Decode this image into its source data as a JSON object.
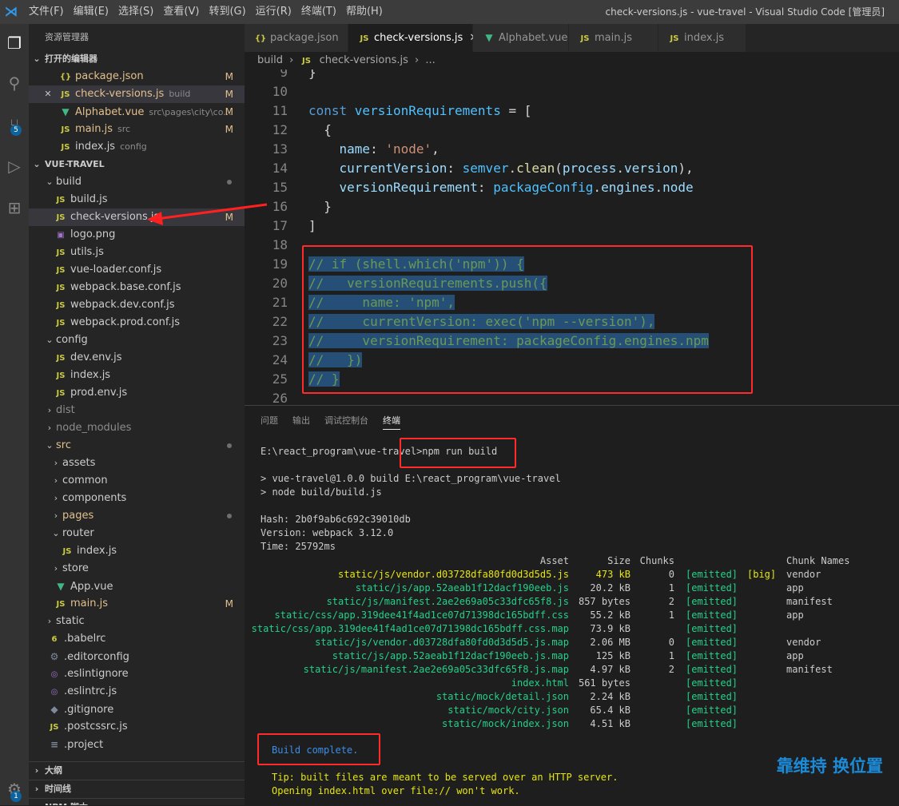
{
  "titlebar": {
    "menus": [
      "文件(F)",
      "编辑(E)",
      "选择(S)",
      "查看(V)",
      "转到(G)",
      "运行(R)",
      "终端(T)",
      "帮助(H)"
    ],
    "window_title": "check-versions.js - vue-travel - Visual Studio Code [管理员]"
  },
  "activity": {
    "scm_badge": "5",
    "accounts_badge": "1"
  },
  "sidebar": {
    "title": "资源管理器",
    "open_editors_label": "打开的编辑器",
    "open_editors": [
      {
        "icon": "{}",
        "name": "package.json",
        "desc": "",
        "mod": "M"
      },
      {
        "icon": "JS",
        "name": "check-versions.js",
        "desc": "build",
        "mod": "M"
      },
      {
        "icon": "V",
        "name": "Alphabet.vue",
        "desc": "src\\pages\\city\\co...",
        "mod": "M"
      },
      {
        "icon": "JS",
        "name": "main.js",
        "desc": "src",
        "mod": "M"
      },
      {
        "icon": "JS",
        "name": "index.js",
        "desc": "config",
        "mod": ""
      }
    ],
    "project_label": "VUE-TRAVEL",
    "tree": [
      {
        "name": "build",
        "kind": "folder-open",
        "depth": 0,
        "dot": true
      },
      {
        "name": "build.js",
        "kind": "js",
        "depth": 1
      },
      {
        "name": "check-versions.js",
        "kind": "js",
        "depth": 1,
        "mod": "M",
        "selected": true
      },
      {
        "name": "logo.png",
        "kind": "img",
        "depth": 1
      },
      {
        "name": "utils.js",
        "kind": "js",
        "depth": 1
      },
      {
        "name": "vue-loader.conf.js",
        "kind": "js",
        "depth": 1
      },
      {
        "name": "webpack.base.conf.js",
        "kind": "js",
        "depth": 1
      },
      {
        "name": "webpack.dev.conf.js",
        "kind": "js",
        "depth": 1
      },
      {
        "name": "webpack.prod.conf.js",
        "kind": "js",
        "depth": 1
      },
      {
        "name": "config",
        "kind": "folder-open",
        "depth": 0
      },
      {
        "name": "dev.env.js",
        "kind": "js",
        "depth": 1
      },
      {
        "name": "index.js",
        "kind": "js",
        "depth": 1
      },
      {
        "name": "prod.env.js",
        "kind": "js",
        "depth": 1
      },
      {
        "name": "dist",
        "kind": "folder",
        "depth": 0,
        "dim": true
      },
      {
        "name": "node_modules",
        "kind": "folder",
        "depth": 0,
        "dim": true
      },
      {
        "name": "src",
        "kind": "folder-open",
        "depth": 0,
        "dot": true,
        "mod_color": true
      },
      {
        "name": "assets",
        "kind": "folder",
        "depth": 1
      },
      {
        "name": "common",
        "kind": "folder",
        "depth": 1
      },
      {
        "name": "components",
        "kind": "folder",
        "depth": 1
      },
      {
        "name": "pages",
        "kind": "folder",
        "depth": 1,
        "dot": true,
        "mod_color": true
      },
      {
        "name": "router",
        "kind": "folder-open",
        "depth": 1
      },
      {
        "name": "index.js",
        "kind": "js",
        "depth": 2
      },
      {
        "name": "store",
        "kind": "folder",
        "depth": 1
      },
      {
        "name": "App.vue",
        "kind": "vue",
        "depth": 1
      },
      {
        "name": "main.js",
        "kind": "js",
        "depth": 1,
        "mod": "M",
        "mod_color": true
      },
      {
        "name": "static",
        "kind": "folder",
        "depth": 0
      },
      {
        "name": ".babelrc",
        "kind": "babel",
        "depth": 0
      },
      {
        "name": ".editorconfig",
        "kind": "gear",
        "depth": 0
      },
      {
        "name": ".eslintignore",
        "kind": "eslint",
        "depth": 0
      },
      {
        "name": ".eslintrc.js",
        "kind": "eslint",
        "depth": 0
      },
      {
        "name": ".gitignore",
        "kind": "git",
        "depth": 0
      },
      {
        "name": ".postcssrc.js",
        "kind": "js",
        "depth": 0
      },
      {
        "name": ".project",
        "kind": "file",
        "depth": 0
      }
    ],
    "outline_label": "大纲",
    "timeline_label": "时间线",
    "npm_label": "NPM 脚本"
  },
  "tabs": [
    {
      "icon": "{}",
      "label": "package.json",
      "active": false
    },
    {
      "icon": "JS",
      "label": "check-versions.js",
      "active": true
    },
    {
      "icon": "V",
      "label": "Alphabet.vue",
      "active": false
    },
    {
      "icon": "JS",
      "label": "main.js",
      "active": false
    },
    {
      "icon": "JS",
      "label": "index.js",
      "active": false
    }
  ],
  "breadcrumb": {
    "folder": "build",
    "file": "check-versions.js",
    "more": "..."
  },
  "editor": {
    "lines": [
      {
        "n": "9",
        "tokens": [
          {
            "t": "}",
            "c": "pun"
          }
        ]
      },
      {
        "n": "10",
        "tokens": []
      },
      {
        "n": "11",
        "tokens": [
          {
            "t": "const ",
            "c": "kw"
          },
          {
            "t": "versionRequirements",
            "c": "var"
          },
          {
            "t": " = [",
            "c": "pun"
          }
        ]
      },
      {
        "n": "12",
        "tokens": [
          {
            "t": "  {",
            "c": "pun"
          }
        ]
      },
      {
        "n": "13",
        "tokens": [
          {
            "t": "    name",
            "c": "prop"
          },
          {
            "t": ": ",
            "c": "pun"
          },
          {
            "t": "'node'",
            "c": "str"
          },
          {
            "t": ",",
            "c": "pun"
          }
        ]
      },
      {
        "n": "14",
        "tokens": [
          {
            "t": "    currentVersion",
            "c": "prop"
          },
          {
            "t": ": ",
            "c": "pun"
          },
          {
            "t": "semver",
            "c": "var"
          },
          {
            "t": ".",
            "c": "pun"
          },
          {
            "t": "clean",
            "c": "fn"
          },
          {
            "t": "(",
            "c": "pun"
          },
          {
            "t": "process",
            "c": "prop"
          },
          {
            "t": ".",
            "c": "pun"
          },
          {
            "t": "version",
            "c": "prop"
          },
          {
            "t": "),",
            "c": "pun"
          }
        ]
      },
      {
        "n": "15",
        "tokens": [
          {
            "t": "    versionRequirement",
            "c": "prop"
          },
          {
            "t": ": ",
            "c": "pun"
          },
          {
            "t": "packageConfig",
            "c": "var"
          },
          {
            "t": ".",
            "c": "pun"
          },
          {
            "t": "engines",
            "c": "prop"
          },
          {
            "t": ".",
            "c": "pun"
          },
          {
            "t": "node",
            "c": "prop"
          }
        ]
      },
      {
        "n": "16",
        "tokens": [
          {
            "t": "  }",
            "c": "pun"
          }
        ]
      },
      {
        "n": "17",
        "tokens": [
          {
            "t": "]",
            "c": "pun"
          }
        ]
      },
      {
        "n": "18",
        "tokens": []
      },
      {
        "n": "19",
        "tokens": [
          {
            "t": "// if (shell.which('npm')) {",
            "c": "cmt hl"
          }
        ]
      },
      {
        "n": "20",
        "tokens": [
          {
            "t": "//   versionRequirements.push({",
            "c": "cmt hl"
          }
        ]
      },
      {
        "n": "21",
        "tokens": [
          {
            "t": "//     name: 'npm',",
            "c": "cmt hl"
          }
        ]
      },
      {
        "n": "22",
        "tokens": [
          {
            "t": "//     currentVersion: exec('npm --version'),",
            "c": "cmt hl"
          }
        ]
      },
      {
        "n": "23",
        "tokens": [
          {
            "t": "//     versionRequirement: packageConfig.engines.npm",
            "c": "cmt hl"
          }
        ]
      },
      {
        "n": "24",
        "tokens": [
          {
            "t": "//   })",
            "c": "cmt hl"
          }
        ]
      },
      {
        "n": "25",
        "tokens": [
          {
            "t": "// }",
            "c": "cmt hl"
          }
        ]
      },
      {
        "n": "26",
        "tokens": []
      }
    ]
  },
  "panel": {
    "tabs": [
      "问题",
      "输出",
      "调试控制台",
      "终端"
    ],
    "active_tab": "终端",
    "prompt": "E:\\react_program\\vue-travel>npm run build",
    "pre_lines": [
      "> vue-travel@1.0.0 build E:\\react_program\\vue-travel",
      "> node build/build.js"
    ],
    "stats": [
      "Hash: 2b0f9ab6c692c39010db",
      "Version: webpack 3.12.0",
      "Time: 25792ms"
    ],
    "table_headers": {
      "asset": "Asset",
      "size": "Size",
      "chunks": "Chunks",
      "names": "Chunk Names"
    },
    "assets": [
      {
        "asset": "static/js/vendor.d03728dfa80fd0d3d5d5.js",
        "size": "473 kB",
        "chunk": "0",
        "status": "[emitted]",
        "big": "[big]",
        "name": "vendor",
        "warn": true
      },
      {
        "asset": "static/js/app.52aeab1f12dacf190eeb.js",
        "size": "20.2 kB",
        "chunk": "1",
        "status": "[emitted]",
        "big": "",
        "name": "app"
      },
      {
        "asset": "static/js/manifest.2ae2e69a05c33dfc65f8.js",
        "size": "857 bytes",
        "chunk": "2",
        "status": "[emitted]",
        "big": "",
        "name": "manifest"
      },
      {
        "asset": "static/css/app.319dee41f4ad1ce07d71398dc165bdff.css",
        "size": "55.2 kB",
        "chunk": "1",
        "status": "[emitted]",
        "big": "",
        "name": "app"
      },
      {
        "asset": "static/css/app.319dee41f4ad1ce07d71398dc165bdff.css.map",
        "size": "73.9 kB",
        "chunk": "",
        "status": "[emitted]",
        "big": "",
        "name": ""
      },
      {
        "asset": "static/js/vendor.d03728dfa80fd0d3d5d5.js.map",
        "size": "2.06 MB",
        "chunk": "0",
        "status": "[emitted]",
        "big": "",
        "name": "vendor"
      },
      {
        "asset": "static/js/app.52aeab1f12dacf190eeb.js.map",
        "size": "125 kB",
        "chunk": "1",
        "status": "[emitted]",
        "big": "",
        "name": "app"
      },
      {
        "asset": "static/js/manifest.2ae2e69a05c33dfc65f8.js.map",
        "size": "4.97 kB",
        "chunk": "2",
        "status": "[emitted]",
        "big": "",
        "name": "manifest"
      },
      {
        "asset": "index.html",
        "size": "561 bytes",
        "chunk": "",
        "status": "[emitted]",
        "big": "",
        "name": ""
      },
      {
        "asset": "static/mock/detail.json",
        "size": "2.24 kB",
        "chunk": "",
        "status": "[emitted]",
        "big": "",
        "name": ""
      },
      {
        "asset": "static/mock/city.json",
        "size": "65.4 kB",
        "chunk": "",
        "status": "[emitted]",
        "big": "",
        "name": ""
      },
      {
        "asset": "static/mock/index.json",
        "size": "4.51 kB",
        "chunk": "",
        "status": "[emitted]",
        "big": "",
        "name": ""
      }
    ],
    "build_complete": "Build complete.",
    "tip": [
      "Tip: built files are meant to be served over an HTTP server.",
      "Opening index.html over file:// won't work."
    ]
  },
  "watermark": "靠维持 换位置"
}
